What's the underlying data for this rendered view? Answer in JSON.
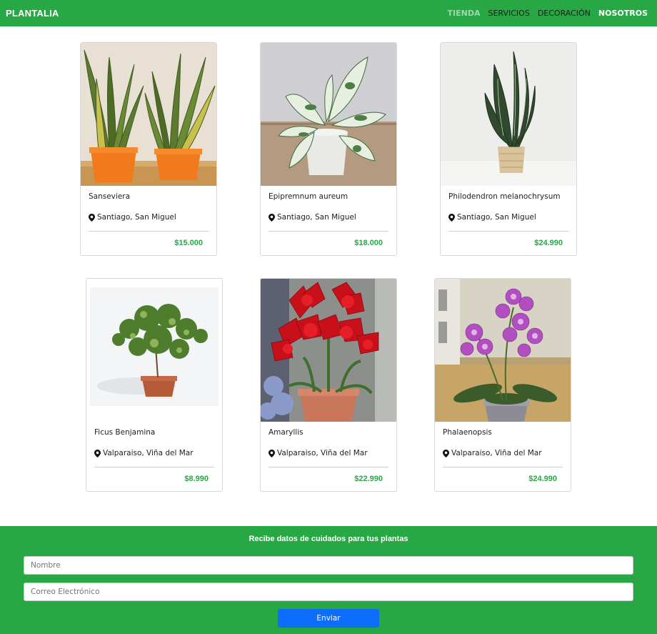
{
  "navbar": {
    "brand": "PLANTALIA",
    "links": [
      "TIENDA",
      "SERVICIOS",
      "DECORACIÓN",
      "NOSOTROS"
    ]
  },
  "products": [
    {
      "name": "Sanseviera",
      "location": "Santiago, San Miguel",
      "price": "$15.000"
    },
    {
      "name": "Epipremnum aureum",
      "location": "Santiago, San Miguel",
      "price": "$18.000"
    },
    {
      "name": "Philodendron melanochrysum",
      "location": "Santiago, San Miguel",
      "price": "$24.990"
    },
    {
      "name": "Ficus Benjamina",
      "location": "Valparaiso, Viña del Mar",
      "price": "$8.990"
    },
    {
      "name": "Amaryllis",
      "location": "Valparaiso, Viña del Mar",
      "price": "$22.990"
    },
    {
      "name": "Phalaenopsis",
      "location": "Valparaiso, Viña del Mar",
      "price": "$24.990"
    }
  ],
  "newsletter": {
    "title": "Recibe datos de cuidados para tus plantas",
    "name_placeholder": "Nombre",
    "email_placeholder": "Correo Electrónico",
    "submit_label": "Enviar"
  },
  "colors": {
    "brand_green": "#28a745",
    "button_blue": "#0d6efd"
  }
}
